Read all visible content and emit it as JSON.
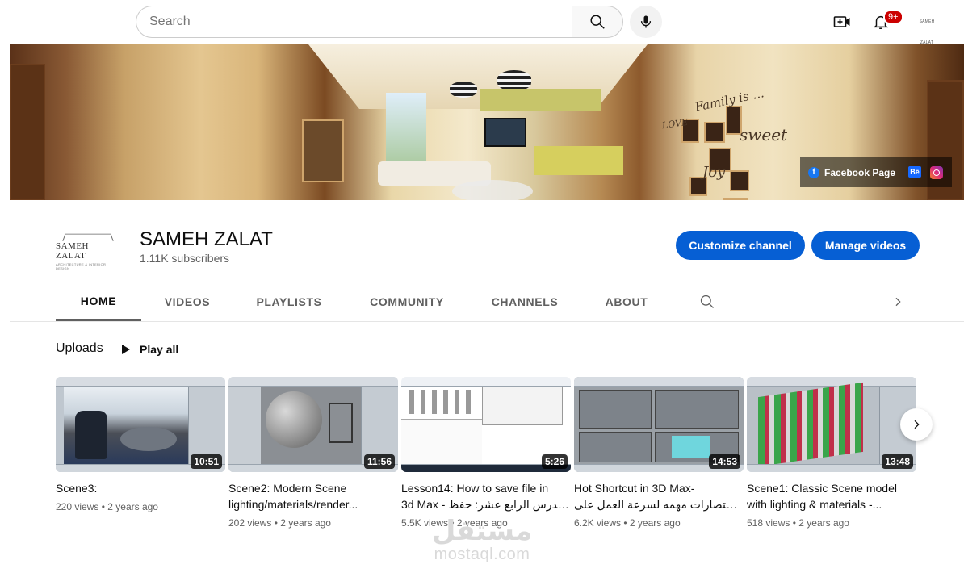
{
  "topbar": {
    "search_placeholder": "Search",
    "notification_count": "9+",
    "account_label": "SAMEH ZALAT"
  },
  "banner": {
    "wall_text_1": "Family is ...",
    "wall_text_2": "sweet",
    "wall_text_3": "LOVE",
    "wall_text_4": "Joy",
    "links": {
      "facebook": "Facebook Page",
      "behance": "Bē"
    }
  },
  "channel": {
    "avatar_text": "SAMEH ZALAT",
    "avatar_sub": "ARCHITECTURE & INTERIOR DESIGN",
    "name": "SAMEH ZALAT",
    "subscribers": "1.11K subscribers",
    "customize_label": "Customize channel",
    "manage_label": "Manage videos"
  },
  "tabs": [
    {
      "label": "HOME",
      "active": true
    },
    {
      "label": "VIDEOS"
    },
    {
      "label": "PLAYLISTS"
    },
    {
      "label": "COMMUNITY"
    },
    {
      "label": "CHANNELS"
    },
    {
      "label": "ABOUT"
    }
  ],
  "uploads": {
    "title": "Uploads",
    "play_all": "Play all",
    "videos": [
      {
        "title_1": "Scene3:",
        "title_2": "",
        "duration": "10:51",
        "views": "220 views",
        "age": "2 years ago"
      },
      {
        "title_1": "Scene2: Modern Scene",
        "title_2": "lighting/materials/render...",
        "duration": "11:56",
        "views": "202 views",
        "age": "2 years ago"
      },
      {
        "title_1": "Lesson14: How to save file in",
        "title_2": "3d Max - الدرس الرابع عشر: حفظ...",
        "duration": "5:26",
        "views": "5.5K views",
        "age": "2 years ago"
      },
      {
        "title_1": "Hot Shortcut in 3D Max-",
        "title_2": "اختصارات مهمه لسرعة العمل على...",
        "duration": "14:53",
        "views": "6.2K views",
        "age": "2 years ago"
      },
      {
        "title_1": "Scene1: Classic Scene model",
        "title_2": "with lighting & materials -...",
        "duration": "13:48",
        "views": "518 views",
        "age": "2 years ago"
      }
    ]
  },
  "watermark": {
    "arabic": "مستقل",
    "latin": "mostaql.com"
  }
}
